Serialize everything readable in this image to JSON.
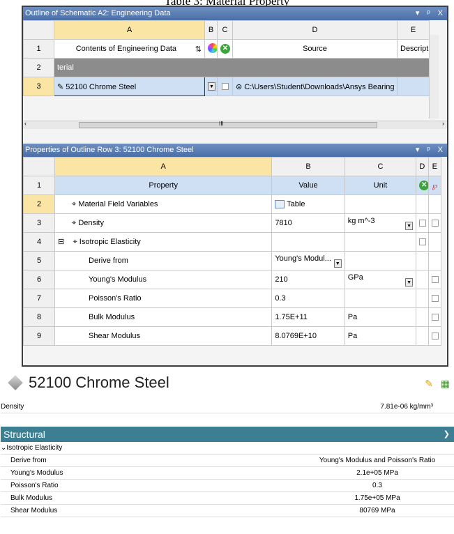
{
  "caption": "Table 3: Material Property",
  "outline": {
    "title": "Outline of Schematic A2: Engineering Data",
    "window_controls": [
      "▾",
      "ᵖ",
      "X"
    ],
    "columns": [
      "A",
      "B",
      "C",
      "D",
      "E"
    ],
    "rows": [
      {
        "num": "1",
        "a": "Contents of Engineering Data",
        "d": "Source",
        "e": "Description"
      },
      {
        "num": "2",
        "a": "terial"
      },
      {
        "num": "3",
        "a": "52100 Chrome Steel",
        "d": "C:\\Users\\Student\\Downloads\\Ansys Bearing Pro"
      }
    ],
    "scroll_marker": "III"
  },
  "properties": {
    "title": "Properties of Outline Row 3: 52100 Chrome Steel",
    "window_controls": [
      "▾",
      "ᵖ",
      "X"
    ],
    "columns": [
      "A",
      "B",
      "C",
      "D",
      "E"
    ],
    "rows": [
      {
        "num": "1",
        "a": "Property",
        "b": "Value",
        "c": "Unit"
      },
      {
        "num": "2",
        "a": "Material Field Variables",
        "b": "Table",
        "c": ""
      },
      {
        "num": "3",
        "a": "Density",
        "b": "7810",
        "c": "kg m^-3"
      },
      {
        "num": "4",
        "a": "Isotropic Elasticity",
        "b": "",
        "c": ""
      },
      {
        "num": "5",
        "a": "Derive from",
        "b": "Young's Modul...",
        "c": ""
      },
      {
        "num": "6",
        "a": "Young's Modulus",
        "b": "210",
        "c": "GPa"
      },
      {
        "num": "7",
        "a": "Poisson's Ratio",
        "b": "0.3",
        "c": ""
      },
      {
        "num": "8",
        "a": "Bulk Modulus",
        "b": "1.75E+11",
        "c": "Pa"
      },
      {
        "num": "9",
        "a": "Shear Modulus",
        "b": "8.0769E+10",
        "c": "Pa"
      }
    ],
    "expand_symbol": "⊟"
  },
  "card": {
    "title": "52100 Chrome Steel",
    "density_label": "Density",
    "density_value": "7.81e-06  kg/mm³",
    "section": "Structural",
    "subsection": "Isotropic Elasticity",
    "rows": [
      {
        "label": "Derive from",
        "value": "Young's Modulus and Poisson's Ratio"
      },
      {
        "label": "Young's Modulus",
        "value": "2.1e+05  MPa"
      },
      {
        "label": "Poisson's Ratio",
        "value": "0.3"
      },
      {
        "label": "Bulk Modulus",
        "value": "1.75e+05  MPa"
      },
      {
        "label": "Shear Modulus",
        "value": "80769  MPa"
      }
    ]
  }
}
